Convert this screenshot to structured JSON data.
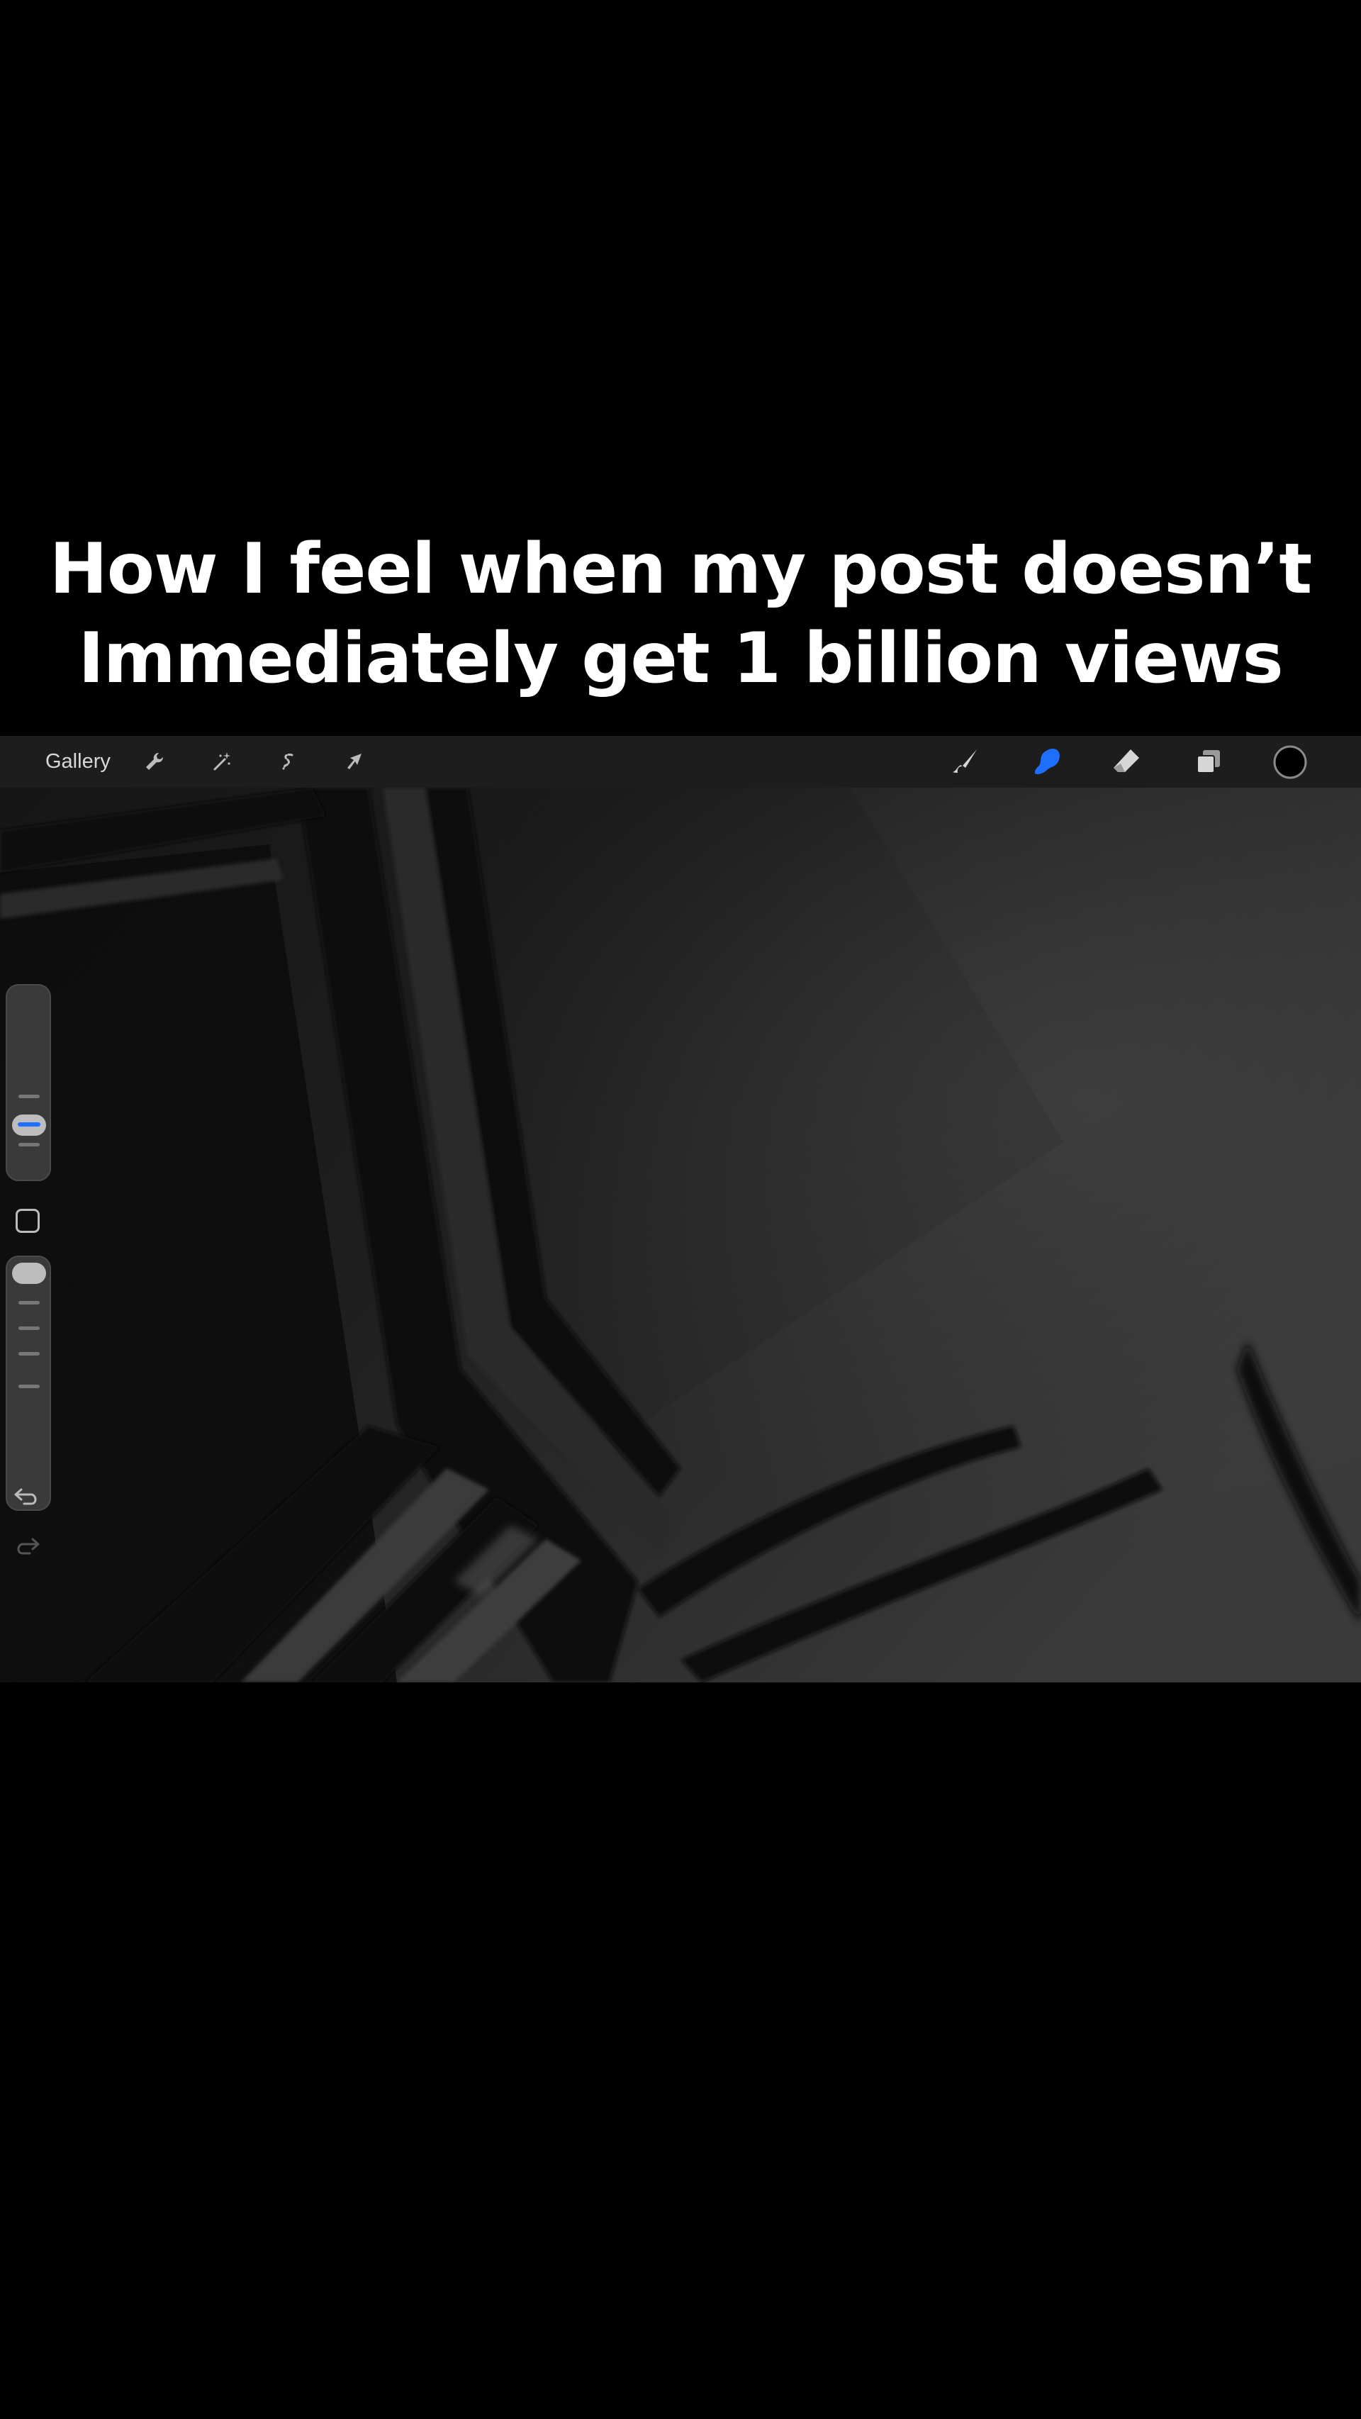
{
  "caption": {
    "line1": "How I feel when my post doesn’t",
    "line2": "Immediately get 1 billion views"
  },
  "toolbar": {
    "gallery_label": "Gallery",
    "left_tools": [
      "wrench-icon",
      "magic-wand-icon",
      "selection-icon",
      "transform-arrow-icon"
    ],
    "right_tools": [
      "brush-icon",
      "smudge-icon",
      "eraser-icon",
      "layers-icon",
      "color-swatch"
    ],
    "active_tool": "smudge-icon"
  },
  "sidebar": {
    "brush_size_level": 0.28,
    "opacity_level": 1.0,
    "modify_button": "square-modifier",
    "undo": "undo-icon",
    "redo": "redo-icon"
  },
  "colors": {
    "accent": "#1f6fff",
    "current_color": "#000000",
    "toolbar_bg": "#1d1d1d",
    "canvas_bg": "#1b1b1b"
  }
}
